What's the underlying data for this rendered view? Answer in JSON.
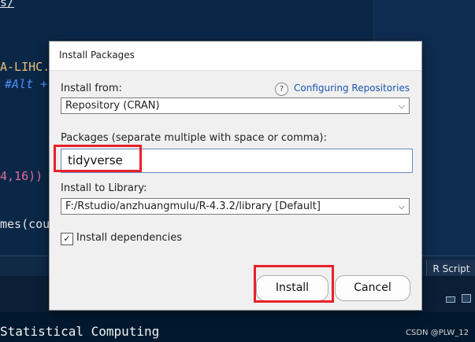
{
  "background": {
    "code_fragments": [
      "s/",
      "A-LIHC.",
      "#Alt +",
      "4,16))",
      "mes(cou"
    ],
    "right_tab_label": "R Script",
    "console_text": "Statistical Computing",
    "watermark": "CSDN @PLW_12"
  },
  "dialog": {
    "title": "Install Packages",
    "install_from_label": "Install from:",
    "help_icon_glyph": "?",
    "configuring_link": "Configuring Repositories",
    "repository_value": "Repository (CRAN)",
    "packages_label": "Packages (separate multiple with space or comma):",
    "packages_value": "tidyverse",
    "install_to_label": "Install to Library:",
    "library_value": "F:/Rstudio/anzhuangmulu/R-4.3.2/library [Default]",
    "dependencies_label": "Install dependencies",
    "dependencies_checked": true,
    "check_glyph": "✓",
    "install_button": "Install",
    "cancel_button": "Cancel"
  },
  "colors": {
    "highlight_red": "#e8202a",
    "link_blue": "#1a56b0"
  }
}
